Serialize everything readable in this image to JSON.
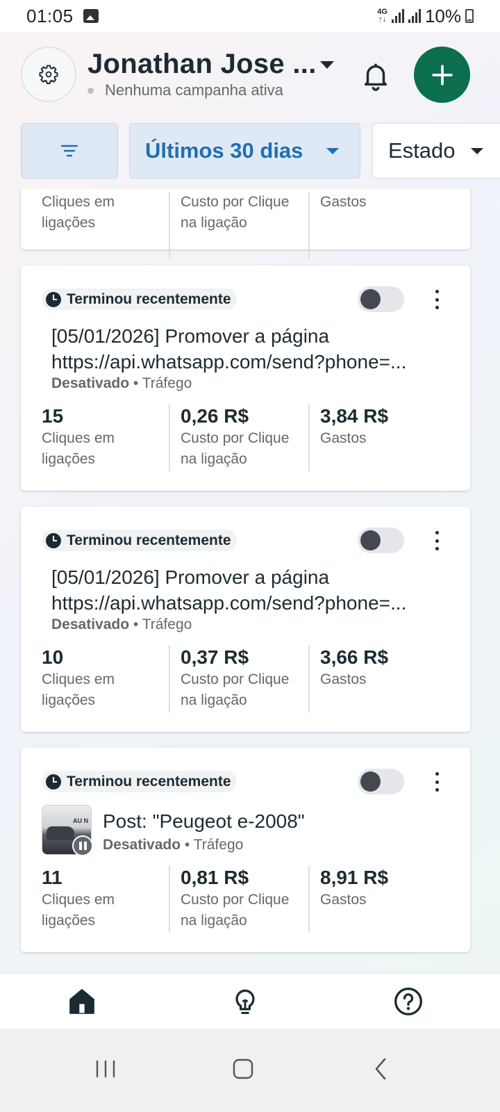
{
  "status_bar": {
    "time": "01:05",
    "network": "4G",
    "battery": "10%"
  },
  "header": {
    "account_name": "Jonathan Jose ...",
    "status_text": "Nenhuma campanha ativa",
    "icons": [
      "gear-icon",
      "bell-icon",
      "plus-icon"
    ],
    "accent_color": "#0b6e4f"
  },
  "filters": {
    "date_range": "Últimos 30 dias",
    "state": "Estado"
  },
  "partial_card": {
    "labels": [
      "Cliques em ligações",
      "Custo por Clique na ligação",
      "Gastos"
    ]
  },
  "campaigns": [
    {
      "badge": "Terminou recentemente",
      "title": "[05/01/2026] Promover a página https://api.whatsapp.com/send?phone=...",
      "title_line1": "[05/01/2026] Promover a página",
      "title_line2": "https://api.whatsapp.com/send?phone=...",
      "status": "Desativado",
      "objective": "Tráfego",
      "clicks": "15",
      "cpc": "0,26 R$",
      "spent": "3,84 R$",
      "enabled": false
    },
    {
      "badge": "Terminou recentemente",
      "title_line1": "[05/01/2026] Promover a página",
      "title_line2": "https://api.whatsapp.com/send?phone=...",
      "status": "Desativado",
      "objective": "Tráfego",
      "clicks": "10",
      "cpc": "0,37 R$",
      "spent": "3,66 R$",
      "enabled": false
    },
    {
      "badge": "Terminou recentemente",
      "title_line1": "Post: \"Peugeot e-2008\"",
      "status": "Desativado",
      "objective": "Tráfego",
      "thumb_text": "AU N",
      "clicks": "11",
      "cpc": "0,81 R$",
      "spent": "8,91 R$",
      "enabled": false
    }
  ],
  "metric_labels": {
    "clicks_line1": "Cliques em",
    "clicks_line2": "ligações",
    "cpc_line1": "Custo por Clique",
    "cpc_line2": "na ligação",
    "spent": "Gastos"
  },
  "bottom_nav": [
    "home-icon",
    "lightbulb-icon",
    "help-icon"
  ],
  "system_nav": [
    "recents-icon",
    "home-button-icon",
    "back-icon"
  ]
}
